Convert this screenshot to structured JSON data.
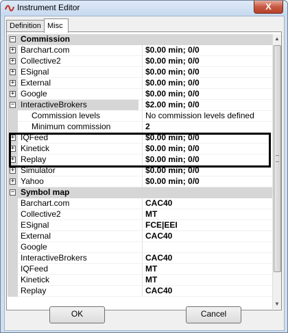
{
  "window": {
    "title": "Instrument Editor",
    "close_label": "X",
    "icon": "app-logo-icon"
  },
  "tabs": [
    {
      "label": "Definition",
      "active": false
    },
    {
      "label": "Misc",
      "active": true
    }
  ],
  "grid": {
    "commission": {
      "category": "Commission",
      "rows": [
        {
          "name": "Barchart.com",
          "value": "$0.00 min;  0/0"
        },
        {
          "name": "Collective2",
          "value": "$0.00 min;  0/0"
        },
        {
          "name": "ESignal",
          "value": "$0.00 min;  0/0"
        },
        {
          "name": "External",
          "value": "$0.00 min;  0/0"
        },
        {
          "name": "Google",
          "value": "$0.00 min;  0/0"
        },
        {
          "name": "InteractiveBrokers",
          "value": "$2.00 min;  0/0"
        },
        {
          "name": "Commission levels",
          "value": "No commission levels defined"
        },
        {
          "name": "Minimum commission",
          "value": "2"
        },
        {
          "name": "IQFeed",
          "value": "$0.00 min;  0/0"
        },
        {
          "name": "Kinetick",
          "value": "$0.00 min;  0/0"
        },
        {
          "name": "Replay",
          "value": "$0.00 min;  0/0"
        },
        {
          "name": "Simulator",
          "value": "$0.00 min;  0/0"
        },
        {
          "name": "Yahoo",
          "value": "$0.00 min;  0/0"
        }
      ]
    },
    "symbol_map": {
      "category": "Symbol map",
      "rows": [
        {
          "name": "Barchart.com",
          "value": "CAC40"
        },
        {
          "name": "Collective2",
          "value": "MT"
        },
        {
          "name": "ESignal",
          "value": "FCE|EEI"
        },
        {
          "name": "External",
          "value": "CAC40"
        },
        {
          "name": "Google",
          "value": ""
        },
        {
          "name": "InteractiveBrokers",
          "value": "CAC40"
        },
        {
          "name": "IQFeed",
          "value": "MT"
        },
        {
          "name": "Kinetick",
          "value": "MT"
        },
        {
          "name": "Replay",
          "value": "CAC40"
        }
      ]
    },
    "expander_plus": "+",
    "expander_minus": "−"
  },
  "buttons": {
    "ok": "OK",
    "cancel": "Cancel"
  },
  "scrollbar": {
    "up": "▲",
    "down": "▼"
  }
}
